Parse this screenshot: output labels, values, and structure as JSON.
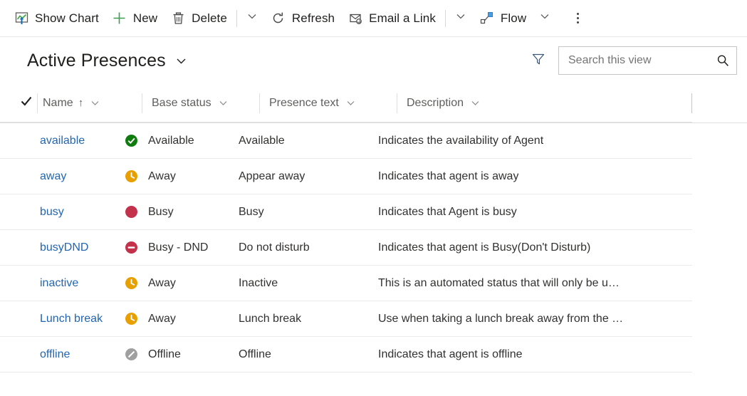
{
  "command_bar": {
    "items": [
      {
        "label": "Show Chart",
        "icon": "show-chart-icon",
        "name": "show-chart"
      },
      {
        "label": "New",
        "icon": "plus-icon",
        "name": "new"
      },
      {
        "label": "Delete",
        "icon": "trash-icon",
        "name": "delete"
      },
      {
        "label": "Refresh",
        "icon": "refresh-icon",
        "name": "refresh"
      },
      {
        "label": "Email a Link",
        "icon": "email-link-icon",
        "name": "email-a-link"
      },
      {
        "label": "Flow",
        "icon": "flow-icon",
        "name": "flow"
      }
    ],
    "overflow_label": "More commands"
  },
  "view": {
    "title": "Active Presences",
    "title_chevron": "chevron-down-icon"
  },
  "search": {
    "placeholder": "Search this view",
    "value": "",
    "icon": "search-icon"
  },
  "filter": {
    "icon": "filter-icon"
  },
  "grid": {
    "select_all": "check-icon",
    "columns": [
      {
        "label": "Name",
        "sort": "↑",
        "name": "column-name"
      },
      {
        "label": "Base status",
        "sort": "",
        "name": "column-base-status"
      },
      {
        "label": "Presence text",
        "sort": "",
        "name": "column-presence-text"
      },
      {
        "label": "Description",
        "sort": "",
        "name": "column-description"
      }
    ],
    "rows": [
      {
        "name": "available",
        "base_status": "Available",
        "status_icon": "available-icon",
        "presence_text": "Available",
        "description": "Indicates the availability of Agent"
      },
      {
        "name": "away",
        "base_status": "Away",
        "status_icon": "away-icon",
        "presence_text": "Appear away",
        "description": "Indicates that agent is away"
      },
      {
        "name": "busy",
        "base_status": "Busy",
        "status_icon": "busy-icon",
        "presence_text": "Busy",
        "description": "Indicates that Agent is busy"
      },
      {
        "name": "busyDND",
        "base_status": "Busy - DND",
        "status_icon": "busy-dnd-icon",
        "presence_text": "Do not disturb",
        "description": "Indicates that agent is Busy(Don't Disturb)"
      },
      {
        "name": "inactive",
        "base_status": "Away",
        "status_icon": "away-icon",
        "presence_text": "Inactive",
        "description": "This is an automated status that will only be u…"
      },
      {
        "name": "Lunch break",
        "base_status": "Away",
        "status_icon": "away-icon",
        "presence_text": "Lunch break",
        "description": "Use when taking a lunch break away from the …"
      },
      {
        "name": "offline",
        "base_status": "Offline",
        "status_icon": "offline-icon",
        "presence_text": "Offline",
        "description": "Indicates that agent is offline"
      }
    ]
  },
  "colors": {
    "link": "#2266b3",
    "available": "#107c10",
    "away": "#e8a000",
    "busy": "#c4314b",
    "offline": "#a0a0a0",
    "chart_green": "#49a849",
    "flow_blue": "#0078d4"
  }
}
